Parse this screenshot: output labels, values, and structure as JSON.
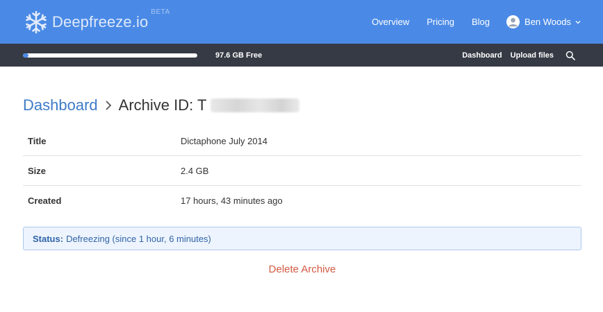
{
  "header": {
    "brand_name": "Deepfreeze.io",
    "beta_badge": "BETA",
    "nav": [
      {
        "label": "Overview"
      },
      {
        "label": "Pricing"
      },
      {
        "label": "Blog"
      }
    ],
    "user_name": "Ben Woods"
  },
  "storage": {
    "used_fraction": 0.03,
    "free_label": "97.6 GB Free",
    "nav": [
      {
        "label": "Dashboard"
      },
      {
        "label": "Upload files"
      }
    ]
  },
  "breadcrumb": {
    "root": "Dashboard",
    "current": "Archive ID: T"
  },
  "details": [
    {
      "key": "Title",
      "value": "Dictaphone July 2014"
    },
    {
      "key": "Size",
      "value": "2.4 GB"
    },
    {
      "key": "Created",
      "value": "17 hours, 43 minutes ago"
    }
  ],
  "status": {
    "label": "Status:",
    "text": "Defreezing (since 1 hour, 6 minutes)"
  },
  "actions": {
    "delete_label": "Delete Archive"
  },
  "colors": {
    "brand_blue": "#4a8ae6",
    "storage_bar_bg": "#353a44",
    "link_blue": "#3e7bc8",
    "danger": "#d25a42"
  }
}
